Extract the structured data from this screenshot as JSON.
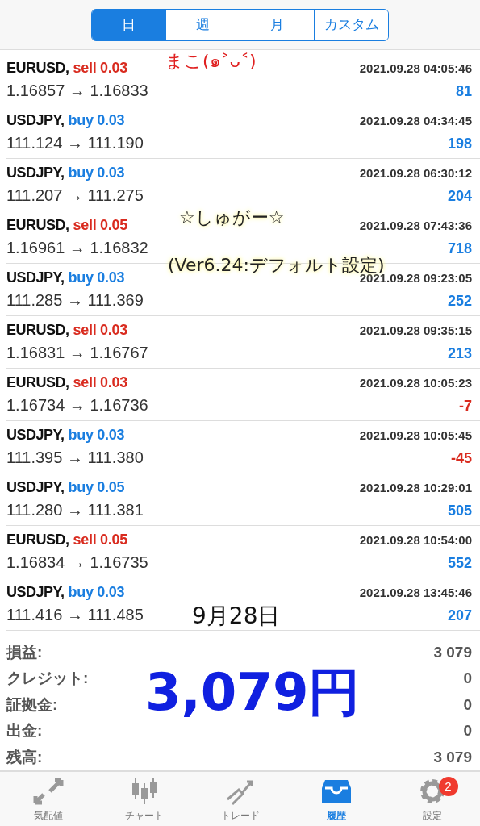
{
  "period_tabs": [
    {
      "label": "日",
      "selected": true
    },
    {
      "label": "週",
      "selected": false
    },
    {
      "label": "月",
      "selected": false
    },
    {
      "label": "カスタム",
      "selected": false
    }
  ],
  "trades": [
    {
      "symbol": "EURUSD,",
      "side": "sell 0.03",
      "kind": "sell",
      "time": "2021.09.28 04:05:46",
      "prices": "1.16857 → 1.16833",
      "profit": "81",
      "loss": false
    },
    {
      "symbol": "USDJPY,",
      "side": "buy 0.03",
      "kind": "buy",
      "time": "2021.09.28 04:34:45",
      "prices": "111.124 → 111.190",
      "profit": "198",
      "loss": false
    },
    {
      "symbol": "USDJPY,",
      "side": "buy 0.03",
      "kind": "buy",
      "time": "2021.09.28 06:30:12",
      "prices": "111.207 → 111.275",
      "profit": "204",
      "loss": false
    },
    {
      "symbol": "EURUSD,",
      "side": "sell 0.05",
      "kind": "sell",
      "time": "2021.09.28 07:43:36",
      "prices": "1.16961 → 1.16832",
      "profit": "718",
      "loss": false
    },
    {
      "symbol": "USDJPY,",
      "side": "buy 0.03",
      "kind": "buy",
      "time": "2021.09.28 09:23:05",
      "prices": "111.285 → 111.369",
      "profit": "252",
      "loss": false
    },
    {
      "symbol": "EURUSD,",
      "side": "sell 0.03",
      "kind": "sell",
      "time": "2021.09.28 09:35:15",
      "prices": "1.16831 → 1.16767",
      "profit": "213",
      "loss": false
    },
    {
      "symbol": "EURUSD,",
      "side": "sell 0.03",
      "kind": "sell",
      "time": "2021.09.28 10:05:23",
      "prices": "1.16734 → 1.16736",
      "profit": "-7",
      "loss": true
    },
    {
      "symbol": "USDJPY,",
      "side": "buy 0.03",
      "kind": "buy",
      "time": "2021.09.28 10:05:45",
      "prices": "111.395 → 111.380",
      "profit": "-45",
      "loss": true
    },
    {
      "symbol": "USDJPY,",
      "side": "buy 0.05",
      "kind": "buy",
      "time": "2021.09.28 10:29:01",
      "prices": "111.280 → 111.381",
      "profit": "505",
      "loss": false
    },
    {
      "symbol": "EURUSD,",
      "side": "sell 0.05",
      "kind": "sell",
      "time": "2021.09.28 10:54:00",
      "prices": "1.16834 → 1.16735",
      "profit": "552",
      "loss": false
    },
    {
      "symbol": "USDJPY,",
      "side": "buy 0.03",
      "kind": "buy",
      "time": "2021.09.28 13:45:46",
      "prices": "111.416 → 111.485",
      "profit": "207",
      "loss": false
    }
  ],
  "summary": [
    {
      "label": "損益:",
      "value": "3 079"
    },
    {
      "label": "クレジット:",
      "value": "0"
    },
    {
      "label": "証拠金:",
      "value": "0"
    },
    {
      "label": "出金:",
      "value": "0"
    },
    {
      "label": "残高:",
      "value": "3 079"
    }
  ],
  "annotations": [
    {
      "text": "まこ(๑˃ᴗ˂)",
      "color": "#e02020",
      "kind": "small"
    },
    {
      "text": "☆しゅがー☆",
      "color": "#222222",
      "kind": "glow"
    },
    {
      "text": "(Ver6.24:デフォルト設定)",
      "color": "#222222",
      "kind": "glow"
    },
    {
      "text": "9月28日",
      "color": "#111111",
      "kind": "medium"
    },
    {
      "text": "3,079円",
      "color": "#1020e0",
      "kind": "large"
    }
  ],
  "nav": [
    {
      "label": "気配値",
      "kind": "quotes",
      "selected": false
    },
    {
      "label": "チャート",
      "kind": "chart",
      "selected": false
    },
    {
      "label": "トレード",
      "kind": "trade",
      "selected": false
    },
    {
      "label": "履歴",
      "kind": "history",
      "selected": true
    },
    {
      "label": "設定",
      "kind": "settings",
      "selected": false,
      "badge": "2"
    }
  ]
}
